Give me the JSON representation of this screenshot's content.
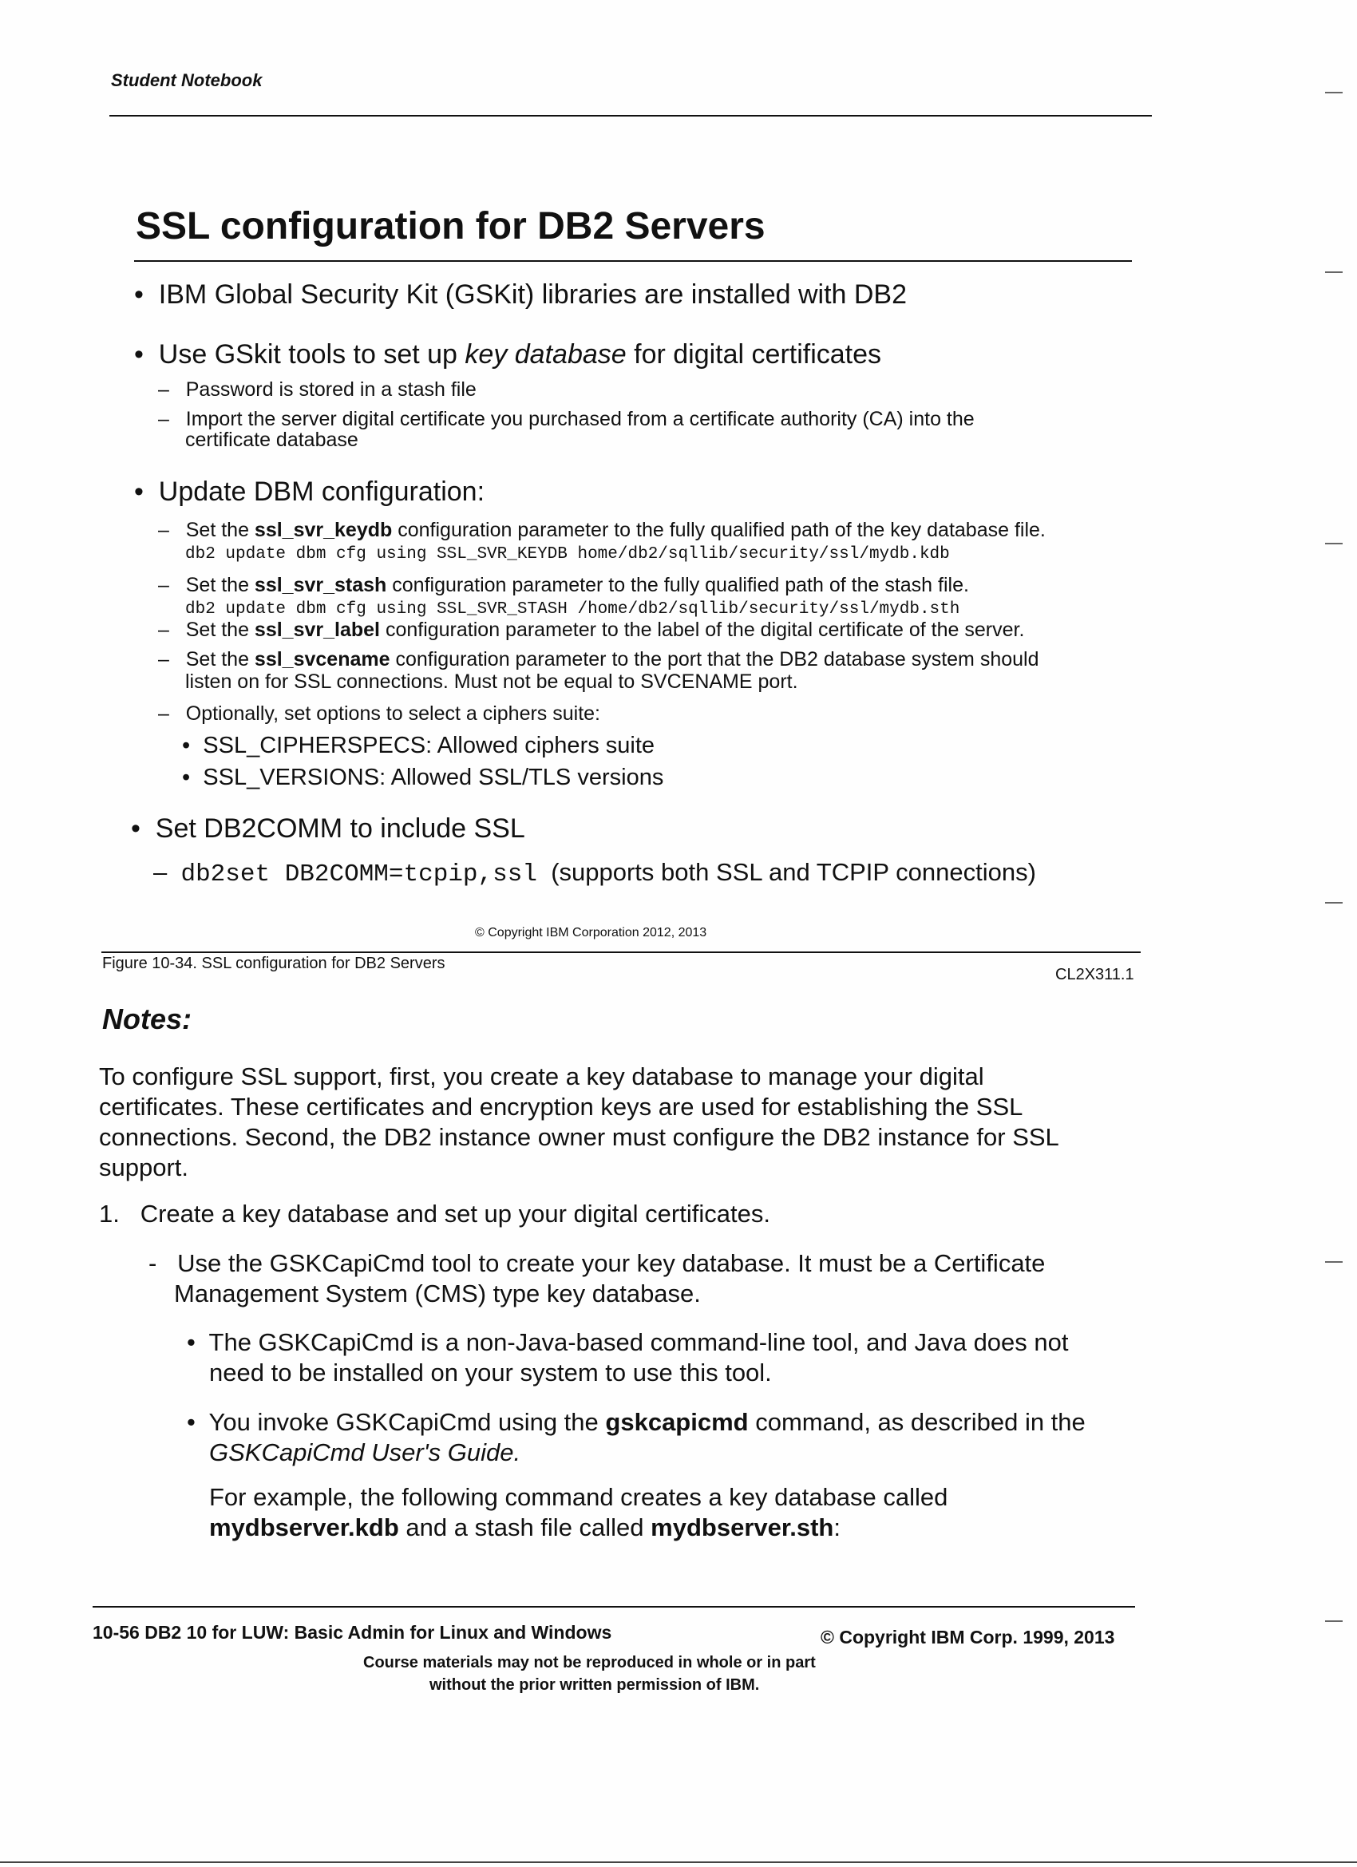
{
  "header": {
    "label": "Student Notebook"
  },
  "slide": {
    "title": "SSL configuration for DB2 Servers",
    "bullet1": "IBM Global Security Kit (GSKit) libraries are installed with DB2",
    "bullet2": {
      "pre": "Use GSkit tools to set up ",
      "em": "key database",
      "post": " for digital certificates"
    },
    "sub2a": "Password is stored in a stash file",
    "sub2b_l1": "Import the server digital certificate you purchased from a certificate authority (CA) into the",
    "sub2b_l2": "certificate database",
    "bullet3": "Update DBM configuration:",
    "keydb": {
      "pre": "Set the ",
      "param": "ssl_svr_keydb",
      "post": " configuration parameter to the fully qualified path of the key database file.",
      "code": "db2 update dbm cfg using SSL_SVR_KEYDB home/db2/sqllib/security/ssl/mydb.kdb"
    },
    "stash": {
      "pre": "Set the ",
      "param": "ssl_svr_stash",
      "post": " configuration parameter to the fully qualified path of the stash file.",
      "code": "db2 update dbm cfg using SSL_SVR_STASH /home/db2/sqllib/security/ssl/mydb.sth"
    },
    "label": {
      "pre": "Set the ",
      "param": "ssl_svr_label",
      "post": " configuration parameter to the label of the digital certificate of the server."
    },
    "svcename": {
      "pre": "Set the ",
      "param": "ssl_svcename",
      "post": " configuration parameter to the port that the DB2 database system should",
      "l2": "listen on for SSL connections. Must not be equal to SVCENAME port."
    },
    "optional": "Optionally, set options to select a ciphers suite:",
    "cipherspecs": "SSL_CIPHERSPECS: Allowed ciphers suite",
    "versions": "SSL_VERSIONS: Allowed SSL/TLS versions",
    "bullet4": "Set DB2COMM to include SSL",
    "db2set_code": "db2set DB2COMM=tcpip,ssl",
    "db2set_note": "(supports both SSL and TCPIP connections)",
    "copyright": "© Copyright IBM Corporation 2012, 2013"
  },
  "figure": {
    "caption": "Figure 10-34.  SSL configuration for DB2 Servers",
    "code": "CL2X311.1"
  },
  "notes": {
    "heading": "Notes:",
    "para": [
      "To configure SSL support, first, you create a key database to manage your digital",
      "certificates. These certificates and encryption keys are used for establishing the SSL",
      "connections. Second, the DB2 instance owner must configure the DB2 instance for SSL",
      "support."
    ],
    "step1_num": "1.",
    "step1": "Create a key database and set up your digital certificates.",
    "dash_l1": "Use the GSKCapiCmd tool to create your key database. It must be a Certificate",
    "dash_l2": "Management System (CMS) type key database.",
    "b1_l1": "The GSKCapiCmd is a non-Java-based command-line tool, and Java does not",
    "b1_l2": "need to be installed on your system to use this tool.",
    "b2_pre": "You invoke GSKCapiCmd using the ",
    "b2_cmd": "gskcapicmd",
    "b2_post": " command, as described in the",
    "b2_l2": "GSKCapiCmd User's Guide.",
    "ex_l1": "For example, the following command creates a key database called",
    "ex_kdb": "mydbserver.kdb",
    "ex_mid": " and a stash file called ",
    "ex_sth": "mydbserver.sth",
    "ex_end": ":"
  },
  "footer": {
    "left": "10-56 DB2 10 for LUW: Basic Admin for Linux and Windows",
    "right": "© Copyright IBM Corp. 1999, 2013",
    "line1": "Course materials may not be reproduced in whole or in part",
    "line2": "without the prior written permission of IBM."
  }
}
